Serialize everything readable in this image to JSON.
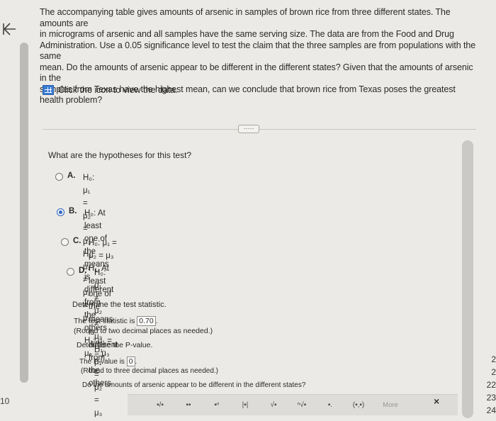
{
  "nav": {
    "back_icon": "back-arrow-icon",
    "left_number": "10"
  },
  "problem": {
    "lines": [
      "The accompanying table gives amounts of arsenic in samples of brown rice from three different states. The amounts are",
      "in micrograms of arsenic and all samples have the same serving size. The data are from the Food and Drug",
      "Administration. Use a 0.05 significance level to test the claim that the three samples are from populations with the same",
      "mean. Do the amounts of arsenic appear to be different in the different states? Given that the amounts of arsenic in the",
      "samples from Texas have the highest mean, can we conclude that brown rice from Texas poses the greatest",
      "health problem?"
    ],
    "data_link": "Click the icon to view the data."
  },
  "more_button": "·····",
  "question": "What are the hypotheses for this test?",
  "options": [
    {
      "letter": "A.",
      "h0": "H₀: μ₁ = μ₂ = μ₃",
      "h1": "H₁: μ₁ ≠ μ₂ ≠ μ₃",
      "selected": false
    },
    {
      "letter": "B.",
      "h0": "H₀: At least one of the means is different from the others",
      "h1": "H₁: μ₁ = μ₂ = μ₃",
      "selected": true
    },
    {
      "letter": "C.",
      "h0": "H₀: μ₁ = μ₂ = μ₃",
      "h1": "H₁: At least one of the means is different from the others",
      "selected": false
    },
    {
      "letter": "D.",
      "h0": "H₀: μ₁ ≠ μ₂ ≠ μ₃",
      "h1": "H₁: μ₁ = μ₂ = μ₃",
      "selected": false
    }
  ],
  "test_stat": {
    "label": "Determine the test statistic.",
    "prefix": "The test statistic is",
    "value": "0.70",
    "suffix": ".",
    "note": "(Round to two decimal places as needed.)"
  },
  "p_value": {
    "label": "Determine the P-value.",
    "prefix": "The P-value is",
    "value": "0",
    "suffix": ".",
    "note": "(Round to three decimal places as needed.)"
  },
  "difference_question": "Do the amounts of arsenic appear to be different in the different states?",
  "toolbar": {
    "buttons": [
      "▪/▪",
      "▪▪",
      "▪ⁿ",
      "|▪|",
      "√▪",
      "ⁿ√▪",
      "▪.",
      "(▪,▪)"
    ],
    "more_label": "More",
    "close_label": "×"
  },
  "right_numbers": [
    "2",
    "2",
    "22",
    "23",
    "24"
  ]
}
